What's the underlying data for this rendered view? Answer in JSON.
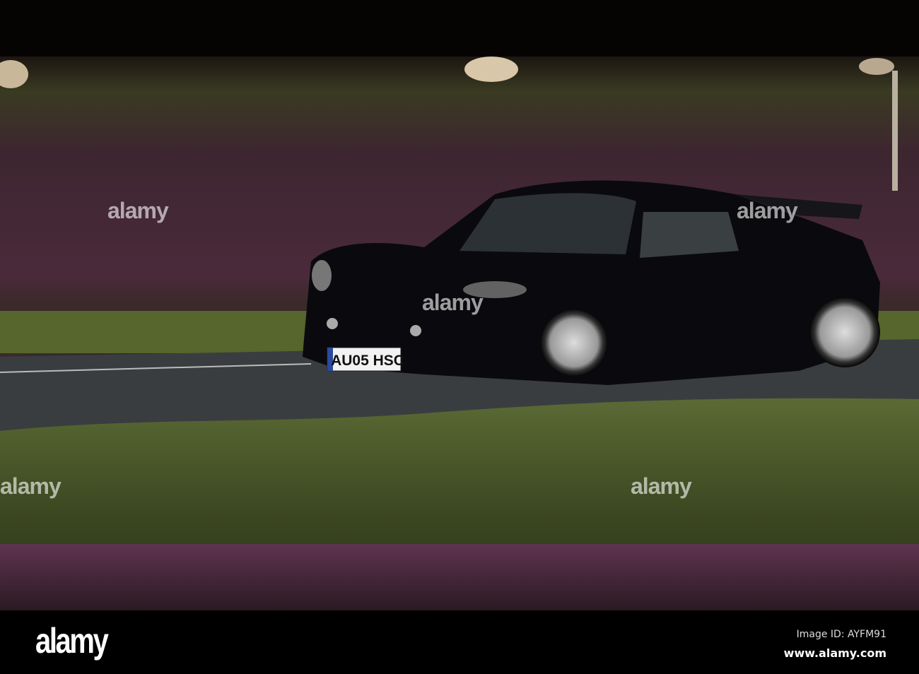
{
  "footer": {
    "logo": "alamy",
    "image_id": "Image ID: AYFM91",
    "url": "www.alamy.com"
  },
  "watermark": "alamy",
  "car": {
    "plate": "AU05 HSC"
  },
  "colors": {
    "heather": "#5a2e42",
    "grass": "#4a5a2a",
    "road": "#3a3d40",
    "car": "#0a0a0e"
  }
}
